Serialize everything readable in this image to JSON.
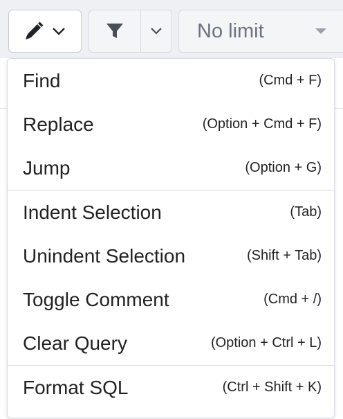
{
  "toolbar": {
    "edit_icon": "pencil-icon",
    "filter_icon": "filter-icon",
    "limit_value": "No limit"
  },
  "menu": {
    "groups": [
      [
        {
          "label": "Find",
          "shortcut": "(Cmd + F)"
        },
        {
          "label": "Replace",
          "shortcut": "(Option + Cmd + F)"
        },
        {
          "label": "Jump",
          "shortcut": "(Option + G)"
        }
      ],
      [
        {
          "label": "Indent Selection",
          "shortcut": "(Tab)"
        },
        {
          "label": "Unindent Selection",
          "shortcut": "(Shift + Tab)"
        },
        {
          "label": "Toggle Comment",
          "shortcut": "(Cmd + /)"
        },
        {
          "label": "Clear Query",
          "shortcut": "(Option + Ctrl + L)"
        }
      ],
      [
        {
          "label": "Format SQL",
          "shortcut": "(Ctrl + Shift + K)"
        }
      ]
    ]
  }
}
